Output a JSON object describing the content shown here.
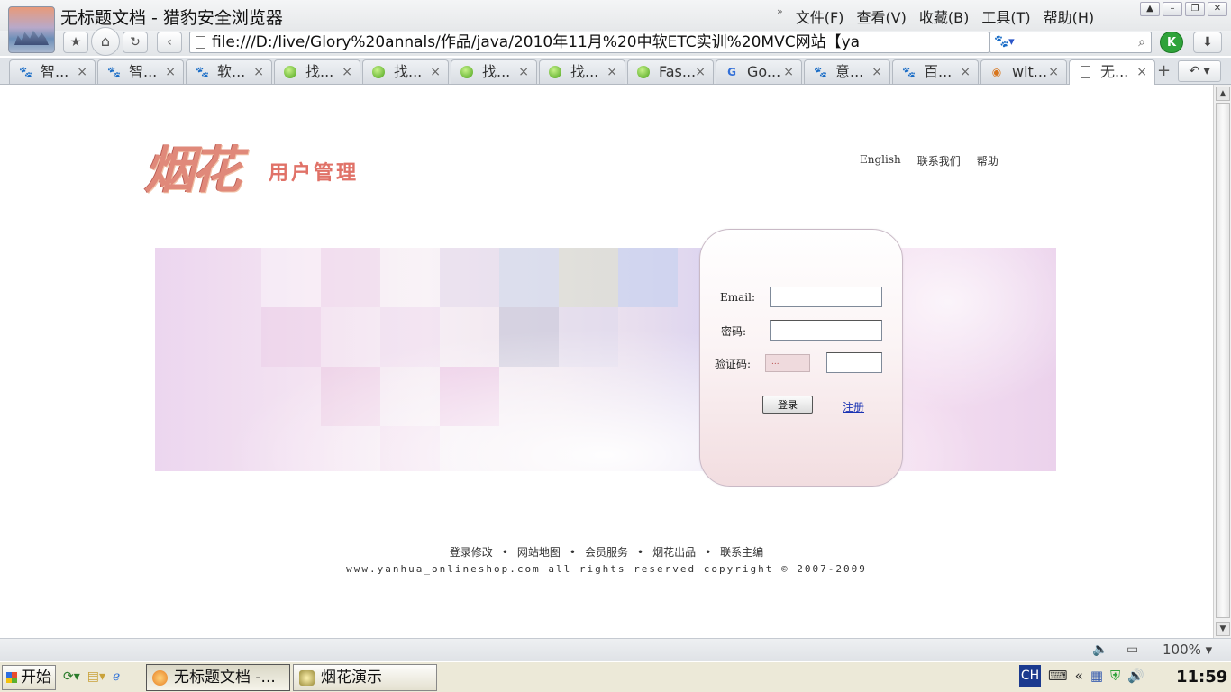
{
  "window": {
    "title": "无标题文档 - 猎豹安全浏览器",
    "menu": [
      "文件(F)",
      "查看(V)",
      "收藏(B)",
      "工具(T)",
      "帮助(H)"
    ]
  },
  "address_bar": {
    "url": "file:///D:/live/Glory%20annals/作品/java/2010年11月%20中软ETC实训%20MVC网站【ya"
  },
  "search_bar": {
    "value": ""
  },
  "tabs": [
    {
      "label": "智...",
      "icon": "paw-icon",
      "active": false
    },
    {
      "label": "智...",
      "icon": "paw-icon",
      "active": false
    },
    {
      "label": "软...",
      "icon": "paw-icon",
      "active": false
    },
    {
      "label": "找...",
      "icon": "green-bulb-icon",
      "active": false
    },
    {
      "label": "找...",
      "icon": "green-bulb-icon",
      "active": false
    },
    {
      "label": "找...",
      "icon": "green-bulb-icon",
      "active": false
    },
    {
      "label": "找...",
      "icon": "green-bulb-icon",
      "active": false
    },
    {
      "label": "Fas...",
      "icon": "green-bulb-icon",
      "active": false
    },
    {
      "label": "Go...",
      "icon": "google-translate-icon",
      "active": false
    },
    {
      "label": "意...",
      "icon": "paw-icon",
      "active": false
    },
    {
      "label": "百...",
      "icon": "paw-icon",
      "active": false
    },
    {
      "label": "wit...",
      "icon": "wit-icon",
      "active": false
    },
    {
      "label": "无...",
      "icon": "document-icon",
      "active": true
    }
  ],
  "page": {
    "logo_text": "烟花",
    "logo_subtitle": "用户管理",
    "top_links": [
      "English",
      "联系我们",
      "帮助"
    ],
    "login": {
      "email_label": "Email:",
      "email_value": "",
      "password_label": "密码:",
      "password_value": "",
      "captcha_label": "验证码:",
      "captcha_value": "",
      "captcha_image_text": "...",
      "login_button": "登录",
      "register_link": "注册"
    },
    "footer_links": [
      "登录修改",
      "网站地图",
      "会员服务",
      "烟花出品",
      "联系主编"
    ],
    "footer_separator": "•",
    "copyright": "www.yanhua_onlineshop.com all rights reserved copyright © 2007-2009"
  },
  "status_bar": {
    "zoom": "100%"
  },
  "taskbar": {
    "start_label": "开始",
    "tasks": [
      {
        "label": "无标题文档 -...",
        "active": true
      },
      {
        "label": "烟花演示",
        "active": false
      }
    ],
    "ime": "CH",
    "clock": "11:59"
  },
  "colors": {
    "logo_accent": "#e0897a",
    "link_blue": "#1a33b3",
    "banner_purple": "#dcd4f0"
  }
}
